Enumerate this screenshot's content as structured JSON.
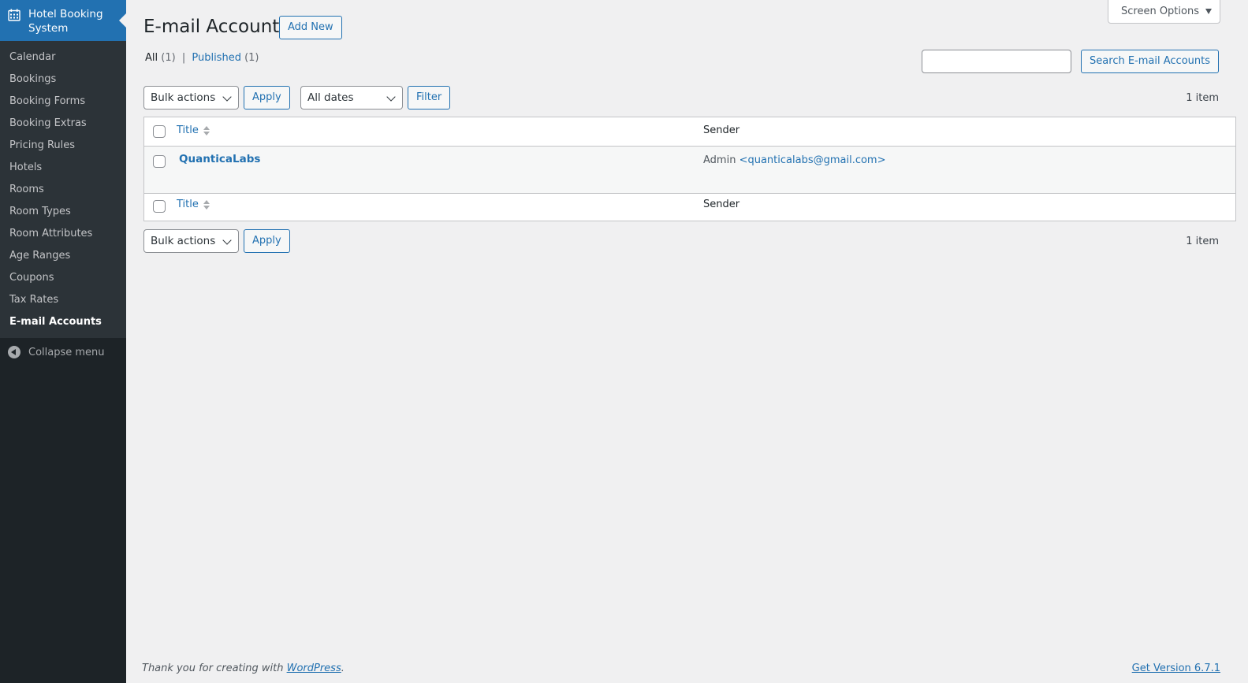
{
  "sidebar": {
    "plugin_title": "Hotel Booking System",
    "items": [
      {
        "label": "Calendar"
      },
      {
        "label": "Bookings"
      },
      {
        "label": "Booking Forms"
      },
      {
        "label": "Booking Extras"
      },
      {
        "label": "Pricing Rules"
      },
      {
        "label": "Hotels"
      },
      {
        "label": "Rooms"
      },
      {
        "label": "Room Types"
      },
      {
        "label": "Room Attributes"
      },
      {
        "label": "Age Ranges"
      },
      {
        "label": "Coupons"
      },
      {
        "label": "Tax Rates"
      },
      {
        "label": "E-mail Accounts"
      }
    ],
    "collapse_label": "Collapse menu"
  },
  "header": {
    "screen_options": "Screen Options",
    "title": "E-mail Accounts",
    "add_new": "Add New"
  },
  "views": {
    "all_label": "All",
    "all_count": "(1)",
    "separator": "|",
    "published_label": "Published",
    "published_count": "(1)"
  },
  "search": {
    "value": "",
    "button": "Search E-mail Accounts"
  },
  "top_nav": {
    "bulk_actions": "Bulk actions",
    "apply": "Apply",
    "dates": "All dates",
    "filter": "Filter",
    "count": "1 item"
  },
  "table": {
    "columns": {
      "title": "Title",
      "sender": "Sender"
    },
    "rows": [
      {
        "title": "QuanticaLabs",
        "sender_name": "Admin",
        "sender_email": "<quanticalabs@gmail.com>"
      }
    ]
  },
  "bottom_nav": {
    "bulk_actions": "Bulk actions",
    "apply": "Apply",
    "count": "1 item"
  },
  "footer": {
    "thanks_prefix": "Thank you for creating with",
    "wordpress_link": "WordPress",
    "thanks_suffix": ".",
    "version_link": "Get Version 6.7.1"
  },
  "colors": {
    "accent": "#2271b1",
    "sidebar_bg": "#1d2327",
    "page_bg": "#f0f0f1"
  }
}
